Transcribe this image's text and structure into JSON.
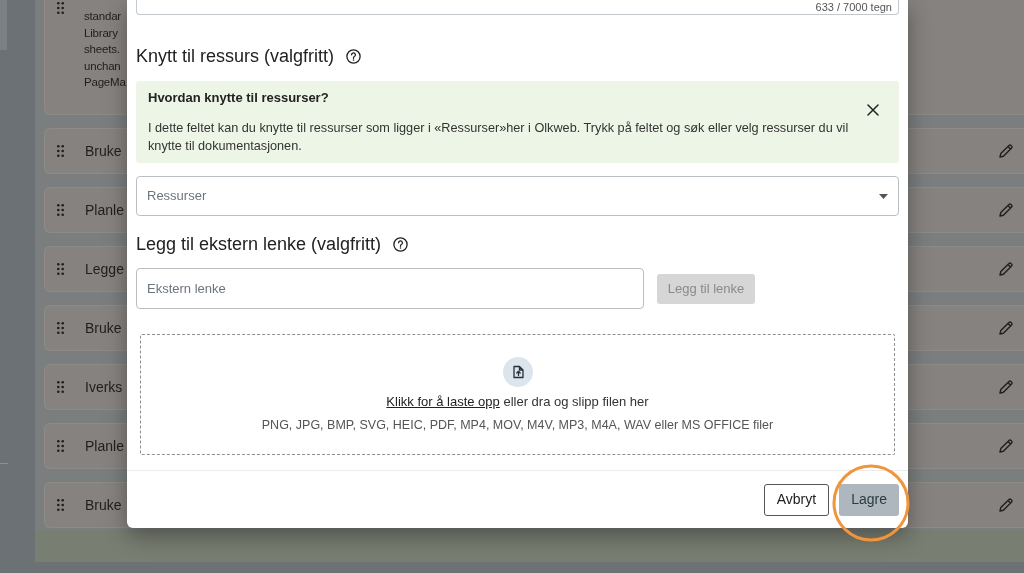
{
  "background": {
    "intro_card": {
      "lines": [
        "standar",
        "Library",
        "sheets.",
        "unchan",
        "PageMa"
      ]
    },
    "items": [
      {
        "title": "Bruke"
      },
      {
        "title": "Planle"
      },
      {
        "title": "Legge"
      },
      {
        "title": "Bruke"
      },
      {
        "title": "Iverks"
      },
      {
        "title": "Planle"
      },
      {
        "title": "Bruke"
      }
    ]
  },
  "modal": {
    "description": {
      "counter": "633 / 7000 tegn"
    },
    "resource_section": {
      "heading": "Knytt til ressurs (valgfritt)"
    },
    "info_alert": {
      "title": "Hvordan knytte til ressurser?",
      "text": "I dette feltet kan du knytte til ressurser som ligger i «Ressurser»her i Olkweb. Trykk på feltet og søk eller velg ressurser du vil knytte til dokumentasjonen."
    },
    "resource_select": {
      "placeholder": "Ressurser"
    },
    "link_section": {
      "heading": "Legg til ekstern lenke (valgfritt)",
      "input": {
        "placeholder": "Ekstern lenke"
      },
      "button": {
        "label": "Legg til lenke",
        "disabled": true
      }
    },
    "upload": {
      "link": "Klikk for å laste opp",
      "text": "eller dra og slipp filen her",
      "formats": "PNG, JPG, BMP, SVG, HEIC, PDF, MP4, MOV, M4V, MP3, M4A, WAV eller MS OFFICE filer"
    },
    "buttons": [
      {
        "kind": "secondary",
        "label": "Avbryt",
        "disabled": false,
        "circled": false
      },
      {
        "kind": "primary",
        "label": "Lagre",
        "disabled": true,
        "circled": true
      }
    ]
  }
}
